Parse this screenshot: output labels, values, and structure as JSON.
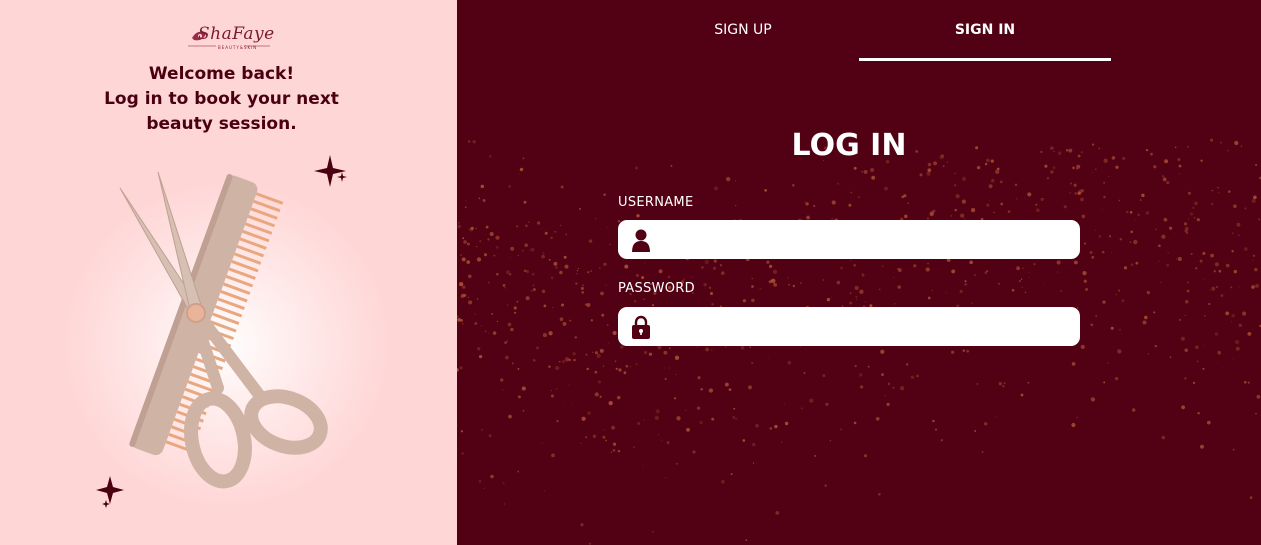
{
  "brand": {
    "logo_text": "ShaFaye",
    "logo_subtext": "BEAUTY&SKIN"
  },
  "welcome": {
    "line1": "Welcome back!",
    "line2": "Log in to book your next",
    "line3": "beauty session."
  },
  "tabs": [
    {
      "label": "SIGN UP",
      "active": false
    },
    {
      "label": "SIGN IN",
      "active": true
    }
  ],
  "form": {
    "title": "LOG IN",
    "username": {
      "label": "USERNAME",
      "value": "",
      "placeholder": "",
      "icon": "user-icon"
    },
    "password": {
      "label": "PASSWORD",
      "value": "",
      "placeholder": "",
      "icon": "lock-icon"
    }
  },
  "colors": {
    "left_bg": "#ffd6d6",
    "right_bg": "#520013",
    "accent": "#4a0010",
    "glitter": "#b3563a"
  }
}
